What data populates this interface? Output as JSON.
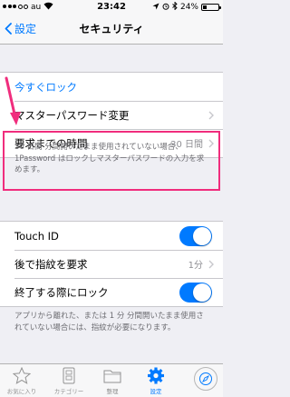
{
  "status_bar": {
    "carrier": "au",
    "time": "23:42",
    "battery": "24%",
    "battery_level": 0.24
  },
  "nav": {
    "back_label": "設定",
    "title": "セキュリティ"
  },
  "lock_now": {
    "label": "今すぐロック"
  },
  "master_password": {
    "label": "マスターパスワード変更"
  },
  "require_time": {
    "label": "要求までの時間",
    "value": "30 日間"
  },
  "require_time_note": "30 日間 分間開いたまま使用されていない場合、1Password はロックしマスターパスワードの入力を求めます。",
  "touch_id": {
    "label": "Touch ID",
    "on": true
  },
  "require_finger_later": {
    "label": "後で指紋を要求",
    "value": "1分"
  },
  "lock_on_exit": {
    "label": "終了する際にロック",
    "on": true
  },
  "lock_note": "アプリから離れた、または 1 分 分間開いたまま使用されていない場合には、指紋が必要になります。",
  "tabs": [
    {
      "label": "お気に入り",
      "icon": "star-icon"
    },
    {
      "label": "カテゴリー",
      "icon": "categories-icon"
    },
    {
      "label": "整理",
      "icon": "folder-icon"
    },
    {
      "label": "設定",
      "icon": "gear-icon",
      "active": true
    }
  ],
  "colors": {
    "accent": "#007aff",
    "highlight": "#f02d7d",
    "background": "#efeff4"
  }
}
